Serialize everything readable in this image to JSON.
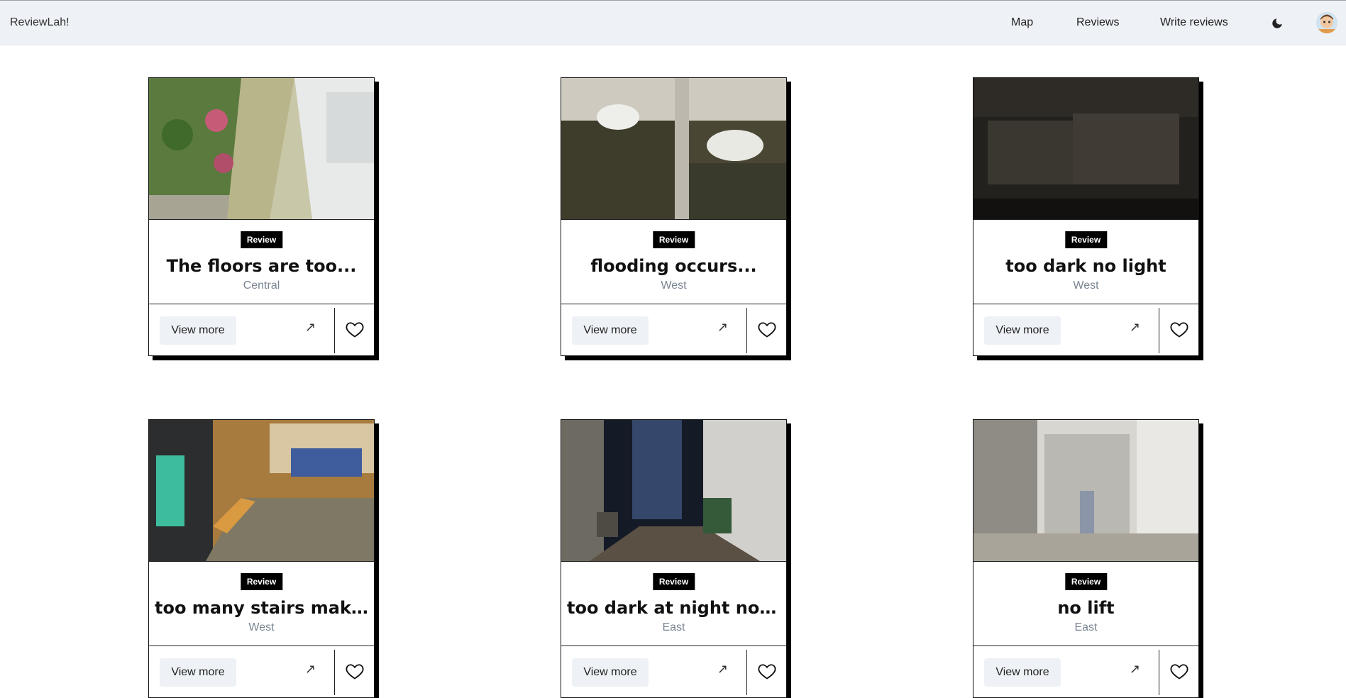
{
  "navbar": {
    "brand": "ReviewLah!",
    "links": [
      "Map",
      "Reviews",
      "Write reviews"
    ],
    "theme_icon": "moon-icon",
    "avatar_icon": "user-avatar"
  },
  "cards": [
    {
      "badge": "Review",
      "title": "The floors are too...",
      "region": "Central",
      "view_label": "View more"
    },
    {
      "badge": "Review",
      "title": "flooding occurs...",
      "region": "West",
      "view_label": "View more"
    },
    {
      "badge": "Review",
      "title": "too dark no light",
      "region": "West",
      "view_label": "View more"
    },
    {
      "badge": "Review",
      "title": "too many stairs makin...",
      "region": "West",
      "view_label": "View more"
    },
    {
      "badge": "Review",
      "title": "too dark at night not...",
      "region": "East",
      "view_label": "View more"
    },
    {
      "badge": "Review",
      "title": "no lift",
      "region": "East",
      "view_label": "View more"
    }
  ],
  "colors": {
    "accent": "#000000",
    "navbar_bg": "#eef1f5",
    "muted_text": "#7a8592"
  }
}
